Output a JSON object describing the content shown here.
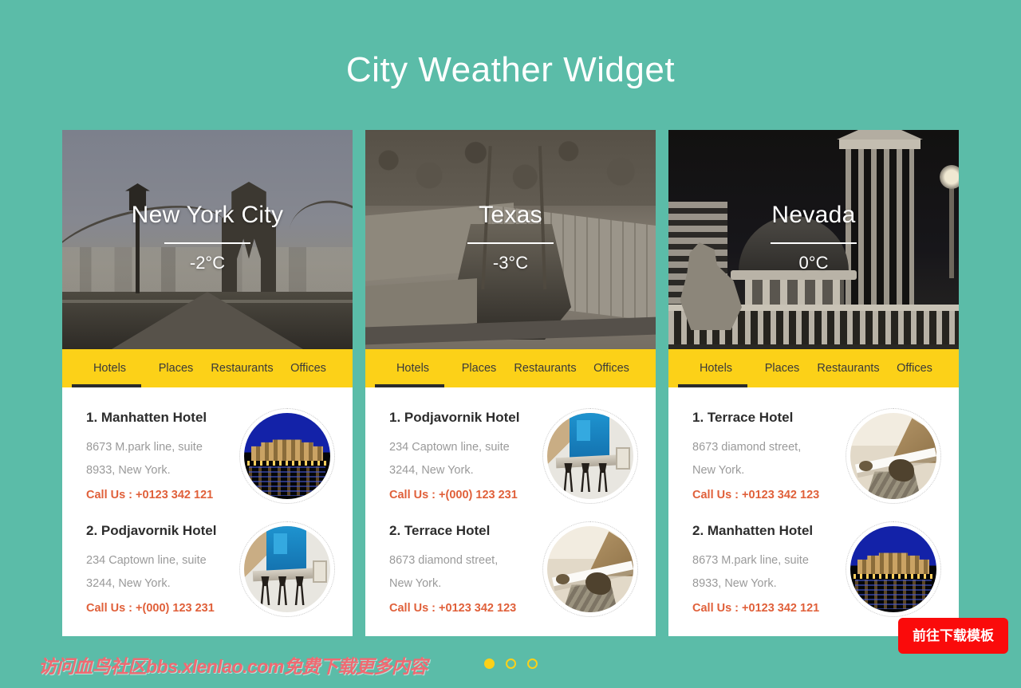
{
  "page": {
    "title": "City Weather Widget",
    "background_color": "#5bbca8",
    "accent_yellow": "#fcd118",
    "accent_orange": "#e0603a"
  },
  "cards": [
    {
      "city": "New York City",
      "temperature": "-2°C",
      "hero_image": "brooklyn-bridge-photo",
      "tabs": [
        {
          "label": "Hotels",
          "active": true
        },
        {
          "label": "Places",
          "active": false
        },
        {
          "label": "Restaurants",
          "active": false
        },
        {
          "label": "Offices",
          "active": false
        }
      ],
      "hotels": [
        {
          "name": "1. Manhatten Hotel",
          "address_line1": "8673 M.park line, suite",
          "address_line2": "8933, New York.",
          "call_label": "Call Us : ",
          "phone": "+0123 342 121",
          "thumb": "hotel-night-photo"
        },
        {
          "name": "2. Podjavornik Hotel",
          "address_line1": "234 Captown line, suite",
          "address_line2": "3244, New York.",
          "call_label": "Call Us : ",
          "phone": "+(000) 123 231",
          "thumb": "cafe-interior-photo"
        }
      ]
    },
    {
      "city": "Texas",
      "temperature": "-3°C",
      "hero_image": "stadium-aerial-photo",
      "tabs": [
        {
          "label": "Hotels",
          "active": true
        },
        {
          "label": "Places",
          "active": false
        },
        {
          "label": "Restaurants",
          "active": false
        },
        {
          "label": "Offices",
          "active": false
        }
      ],
      "hotels": [
        {
          "name": "1. Podjavornik Hotel",
          "address_line1": "234 Captown line, suite",
          "address_line2": "3244, New York.",
          "call_label": "Call Us : ",
          "phone": "+(000) 123 231",
          "thumb": "cafe-interior-photo"
        },
        {
          "name": "2. Terrace Hotel",
          "address_line1": "8673 diamond street,",
          "address_line2": "New York.",
          "call_label": "Call Us : ",
          "phone": "+0123 342 123",
          "thumb": "terrace-coastal-photo"
        }
      ]
    },
    {
      "city": "Nevada",
      "temperature": "0°C",
      "hero_image": "caesars-palace-night-photo",
      "tabs": [
        {
          "label": "Hotels",
          "active": true
        },
        {
          "label": "Places",
          "active": false
        },
        {
          "label": "Restaurants",
          "active": false
        },
        {
          "label": "Offices",
          "active": false
        }
      ],
      "hotels": [
        {
          "name": "1. Terrace Hotel",
          "address_line1": "8673 diamond street,",
          "address_line2": "New York.",
          "call_label": "Call Us : ",
          "phone": "+0123 342 123",
          "thumb": "terrace-coastal-photo"
        },
        {
          "name": "2. Manhatten Hotel",
          "address_line1": "8673 M.park line, suite",
          "address_line2": "8933, New York.",
          "call_label": "Call Us : ",
          "phone": "+0123 342 121",
          "thumb": "hotel-night-photo"
        }
      ]
    }
  ],
  "pagination": {
    "dots": 3,
    "active_index": 0
  },
  "watermark": {
    "text": "访问血鸟社区bbs.xlenlao.com免费下载更多内容",
    "color": "#ef6a72"
  },
  "download_button": {
    "label": "前往下载模板",
    "color": "#fa0b0b"
  }
}
